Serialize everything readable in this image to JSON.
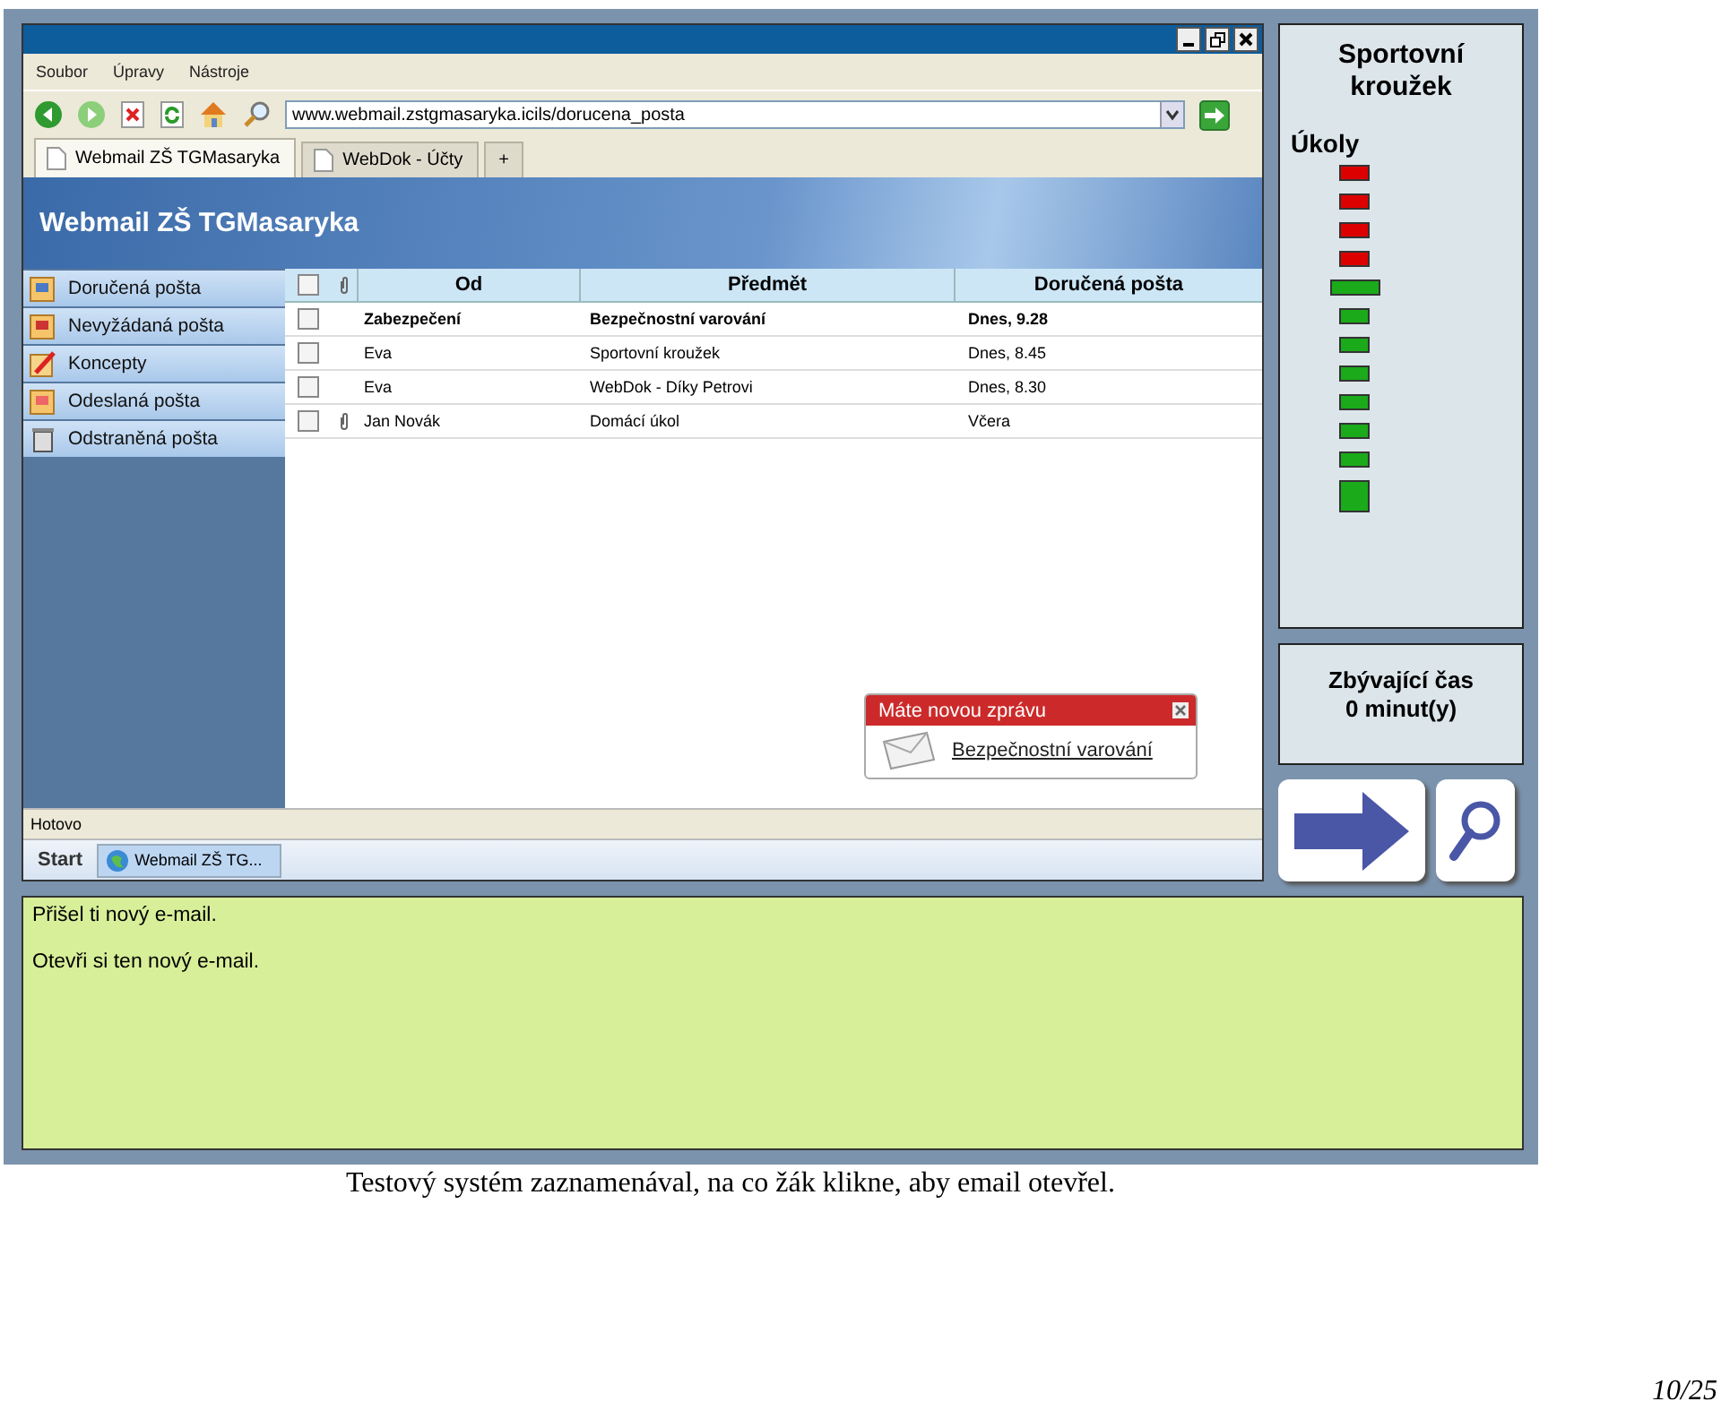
{
  "browser": {
    "menu": [
      "Soubor",
      "Úpravy",
      "Nástroje"
    ],
    "address": "www.webmail.zstgmasaryka.icils/dorucena_posta",
    "tabs": [
      {
        "label": "Webmail ZŠ TGMasaryka",
        "selected": true
      },
      {
        "label": "WebDok - Účty",
        "selected": false
      }
    ],
    "new_tab": "+",
    "banner_title": "Webmail ZŠ TGMasaryka",
    "folders": [
      {
        "label": "Doručená pošta",
        "kind": "inbox"
      },
      {
        "label": "Nevyžádaná pošta",
        "kind": "junk"
      },
      {
        "label": "Koncepty",
        "kind": "drafts"
      },
      {
        "label": "Odeslaná pošta",
        "kind": "sent"
      },
      {
        "label": "Odstraněná pošta",
        "kind": "trash"
      }
    ],
    "columns": [
      "Od",
      "Předmět",
      "Doručená pošta"
    ],
    "select_all_checked": false,
    "rows": [
      {
        "from": "Zabezpečení",
        "subject": "Bezpečnostní varování",
        "date": "Dnes, 9.28",
        "unread": true,
        "attachment": false,
        "checked": false
      },
      {
        "from": "Eva",
        "subject": "Sportovní kroužek",
        "date": "Dnes, 8.45",
        "unread": false,
        "attachment": false,
        "checked": false
      },
      {
        "from": "Eva",
        "subject": "WebDok - Díky Petrovi",
        "date": "Dnes, 8.30",
        "unread": false,
        "attachment": false,
        "checked": false
      },
      {
        "from": "Jan Novák",
        "subject": "Domácí úkol",
        "date": "Včera",
        "unread": false,
        "attachment": true,
        "checked": false
      }
    ],
    "notification": {
      "title": "Máte novou zprávu",
      "link": "Bezpečnostní varování"
    },
    "status": "Hotovo",
    "taskbar": {
      "start": "Start",
      "item": "Webmail ZŠ TG..."
    }
  },
  "panel": {
    "title": "Sportovní kroužek",
    "tasks_label": "Úkoly",
    "tasks": [
      {
        "kind": "bar",
        "color": "#dd0000"
      },
      {
        "kind": "bar",
        "color": "#dd0000"
      },
      {
        "kind": "bar",
        "color": "#dd0000"
      },
      {
        "kind": "bar",
        "color": "#dd0000"
      },
      {
        "kind": "wide",
        "color": "#1aaa1a"
      },
      {
        "kind": "bar",
        "color": "#1aaa1a"
      },
      {
        "kind": "bar",
        "color": "#1aaa1a"
      },
      {
        "kind": "bar",
        "color": "#1aaa1a"
      },
      {
        "kind": "bar",
        "color": "#1aaa1a"
      },
      {
        "kind": "bar",
        "color": "#1aaa1a"
      },
      {
        "kind": "bar",
        "color": "#1aaa1a"
      },
      {
        "kind": "block",
        "color": "#1aaa1a"
      }
    ],
    "time_label": "Zbývající čas",
    "time_value": "0 minut(y)"
  },
  "instructions": [
    "Přišel ti nový e-mail.",
    "Otevři si ten nový e-mail."
  ],
  "caption": "Testový systém zaznamenával, na co žák klikne, aby email otevřel.",
  "page_number": "10/25"
}
